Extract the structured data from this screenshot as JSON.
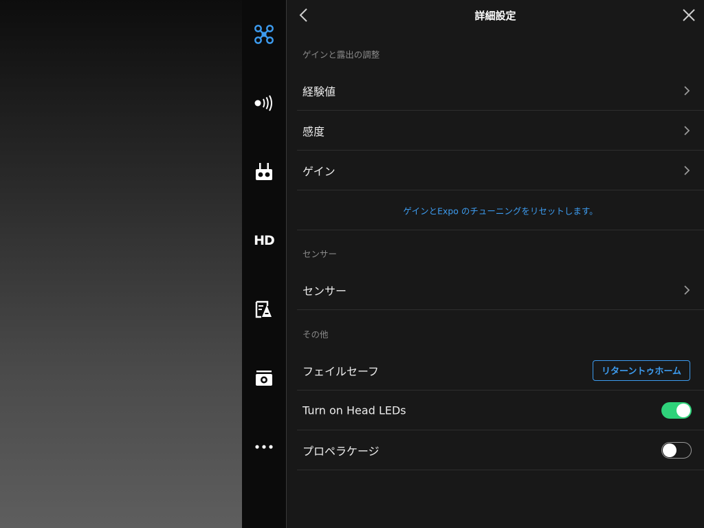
{
  "header": {
    "title": "詳細設定"
  },
  "sidebar": {
    "items": [
      {
        "icon": "drone-icon",
        "active_color": "#3d9cf0"
      },
      {
        "icon": "signal-icon"
      },
      {
        "icon": "remote-controller-icon"
      },
      {
        "icon": "hd-icon",
        "label": "HD"
      },
      {
        "icon": "map-icon"
      },
      {
        "icon": "camera-icon"
      },
      {
        "icon": "more-icon"
      }
    ]
  },
  "sections": {
    "gain": {
      "header": "ゲインと露出の調整",
      "items": [
        "経験値",
        "感度",
        "ゲイン"
      ],
      "reset_link": "ゲインとExpo のチューニングをリセットします。"
    },
    "sensor": {
      "header": "センサー",
      "items": [
        "センサー"
      ]
    },
    "other": {
      "header": "その他",
      "failsafe_label": "フェイルセーフ",
      "failsafe_value": "リターントゥホーム",
      "head_leds_label": "Turn on Head LEDs",
      "head_leds_on": true,
      "prop_guard_label": "プロペラケージ",
      "prop_guard_on": false
    }
  },
  "colors": {
    "accent": "#3d9cf0",
    "toggle_on": "#2fd27a"
  }
}
